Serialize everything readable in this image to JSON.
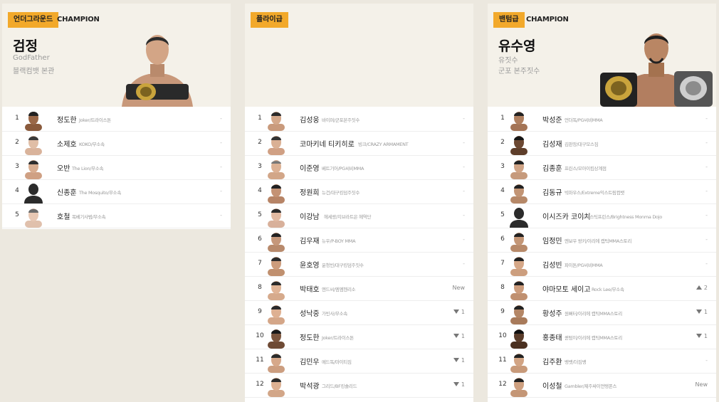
{
  "panels": [
    {
      "division": "언더그라운드",
      "champion_label": "CHAMPION",
      "champion": {
        "name": "검정",
        "nickname": "GodFather",
        "gym": "블랙컴뱃 본관"
      },
      "rows": [
        {
          "rank": "1",
          "name": "정도한",
          "info": "Joker/트라이스톤",
          "trend": "-"
        },
        {
          "rank": "2",
          "name": "소제호",
          "info": "KOKO/무소속",
          "trend": "-"
        },
        {
          "rank": "3",
          "name": "오반",
          "info": "The Lion/무소속",
          "trend": "-"
        },
        {
          "rank": "4",
          "name": "신종훈",
          "info": "The Mosquito/무소속",
          "trend": "-"
        },
        {
          "rank": "5",
          "name": "호철",
          "info": "목베기사범/무소속",
          "trend": "-"
        }
      ]
    },
    {
      "division": "플라이급",
      "champion_label": "",
      "champion": {
        "name": "",
        "nickname": "",
        "gym": ""
      },
      "rows": [
        {
          "rank": "1",
          "name": "김성웅",
          "info": "바이퍼/군포본주짓수",
          "trend": "-"
        },
        {
          "rank": "2",
          "name": "코마키네 티키히로",
          "info": "빙크/CRAZY ARMAMENT",
          "trend": "-"
        },
        {
          "rank": "3",
          "name": "이준영",
          "info": "베트기어/PG씨비MMA",
          "trend": "-"
        },
        {
          "rank": "4",
          "name": "정원희",
          "info": "뉴건/대구킹덤주짓수",
          "trend": "-"
        },
        {
          "rank": "5",
          "name": "이강남",
          "info": "헤세랑/지브라트은 헤역단",
          "trend": "-"
        },
        {
          "rank": "6",
          "name": "김우재",
          "info": "뉴우/P-BOY MMA",
          "trend": "-"
        },
        {
          "rank": "7",
          "name": "윤호영",
          "info": "윤청빈/대구킹덤주짓수",
          "trend": "-"
        },
        {
          "rank": "8",
          "name": "박태호",
          "info": "엔드씨/엠엠헨리소",
          "trend": "New"
        },
        {
          "rank": "9",
          "name": "성낙중",
          "info": "가빈사/무소속",
          "trend": "▼1"
        },
        {
          "rank": "10",
          "name": "정도한",
          "info": "Joker/트라이스톤",
          "trend": "▼1"
        },
        {
          "rank": "11",
          "name": "김민우",
          "info": "메드독/마이티짐",
          "trend": "▼1"
        },
        {
          "rank": "12",
          "name": "박석광",
          "info": "그리드/BF킹솔리드",
          "trend": "▼1"
        }
      ]
    },
    {
      "division": "밴텀급",
      "champion_label": "CHAMPION",
      "champion": {
        "name": "유수영",
        "nickname": "유짓수",
        "gym": "군포 본주짓수"
      },
      "rows": [
        {
          "rank": "1",
          "name": "박성준",
          "info": "언더독/PG씨비MMA",
          "trend": "-"
        },
        {
          "rank": "2",
          "name": "김성재",
          "info": "김판장/대구모스짐",
          "trend": "-"
        },
        {
          "rank": "3",
          "name": "김종훈",
          "info": "프린스/모아이킴상계점",
          "trend": "-"
        },
        {
          "rank": "4",
          "name": "김동규",
          "info": "빅마우스/Extreme익스트림컴뱃",
          "trend": "-"
        },
        {
          "rank": "5",
          "name": "이시즈카 코이치",
          "info": "도제스틱프린스/Brightness Monma Dojo",
          "trend": "-"
        },
        {
          "rank": "6",
          "name": "임정민",
          "info": "엔보우 왕키/이리에 캡틱MMA스토리",
          "trend": "-"
        },
        {
          "rank": "7",
          "name": "김성빈",
          "info": "파이톤/PG씨비MMA",
          "trend": "-"
        },
        {
          "rank": "8",
          "name": "야마모토 세이고",
          "info": "Rock Lee/무소속",
          "trend": "▲2"
        },
        {
          "rank": "9",
          "name": "황성주",
          "info": "원뻐터/이리에 캡틱MMA스토리",
          "trend": "▼1"
        },
        {
          "rank": "10",
          "name": "홍종태",
          "info": "퀸텀이/이리에 캡틱MMA스토리",
          "trend": "▼1"
        },
        {
          "rank": "11",
          "name": "김주환",
          "info": "뱅뱃/더짐뱅",
          "trend": "-"
        },
        {
          "rank": "12",
          "name": "이성철",
          "info": "Gambler/제주싸이언탱폰스",
          "trend": "New"
        }
      ]
    }
  ],
  "colors": {
    "badge": "#f2a92b",
    "header_bg": "#f4f1e9",
    "page_bg": "#ece8df"
  }
}
